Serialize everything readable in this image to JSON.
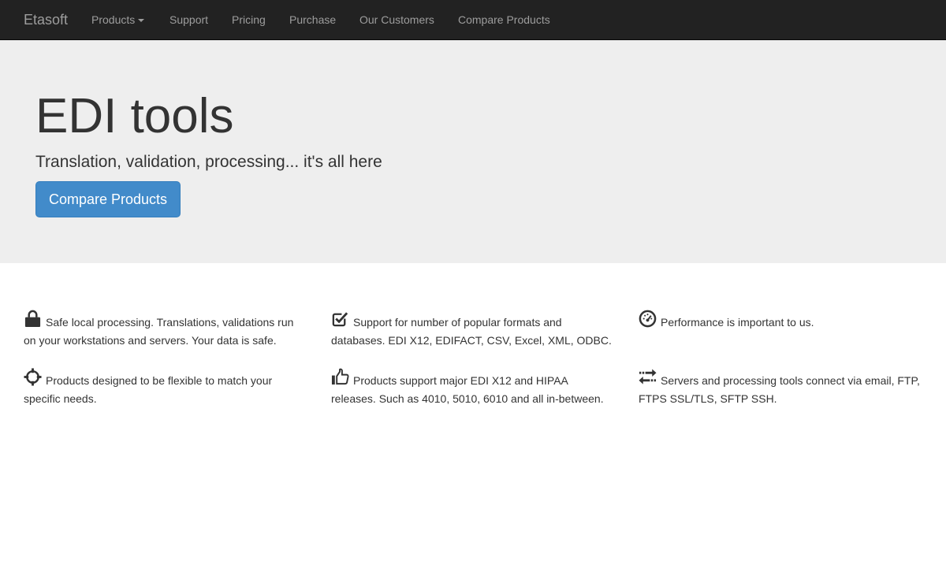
{
  "navbar": {
    "brand": "Etasoft",
    "items": [
      {
        "label": "Products"
      },
      {
        "label": "Support"
      },
      {
        "label": "Pricing"
      },
      {
        "label": "Purchase"
      },
      {
        "label": "Our Customers"
      },
      {
        "label": "Compare Products"
      }
    ]
  },
  "hero": {
    "title": "EDI tools",
    "subtitle": "Translation, validation, processing... it's all here",
    "button_label": "Compare Products"
  },
  "features": [
    {
      "icon": "lock-icon",
      "text": "Safe local processing. Translations, validations run on your workstations and servers. Your data is safe."
    },
    {
      "icon": "check-square-icon",
      "text": "Support for number of popular formats and databases. EDI X12, EDIFACT, CSV, Excel, XML, ODBC."
    },
    {
      "icon": "dashboard-icon",
      "text": "Performance is important to us."
    },
    {
      "icon": "crosshairs-icon",
      "text": "Products designed to be flexible to match your specific needs."
    },
    {
      "icon": "thumbs-up-icon",
      "text": "Products support major EDI X12 and HIPAA releases. Such as 4010, 5010, 6010 and all in-between."
    },
    {
      "icon": "transfer-icon",
      "text": "Servers and processing tools connect via email, FTP, FTPS SSL/TLS, SFTP SSH."
    }
  ],
  "colors": {
    "navbar_bg": "#222222",
    "nav_text": "#9d9d9d",
    "jumbotron_bg": "#eeeeee",
    "primary": "#428bca"
  }
}
